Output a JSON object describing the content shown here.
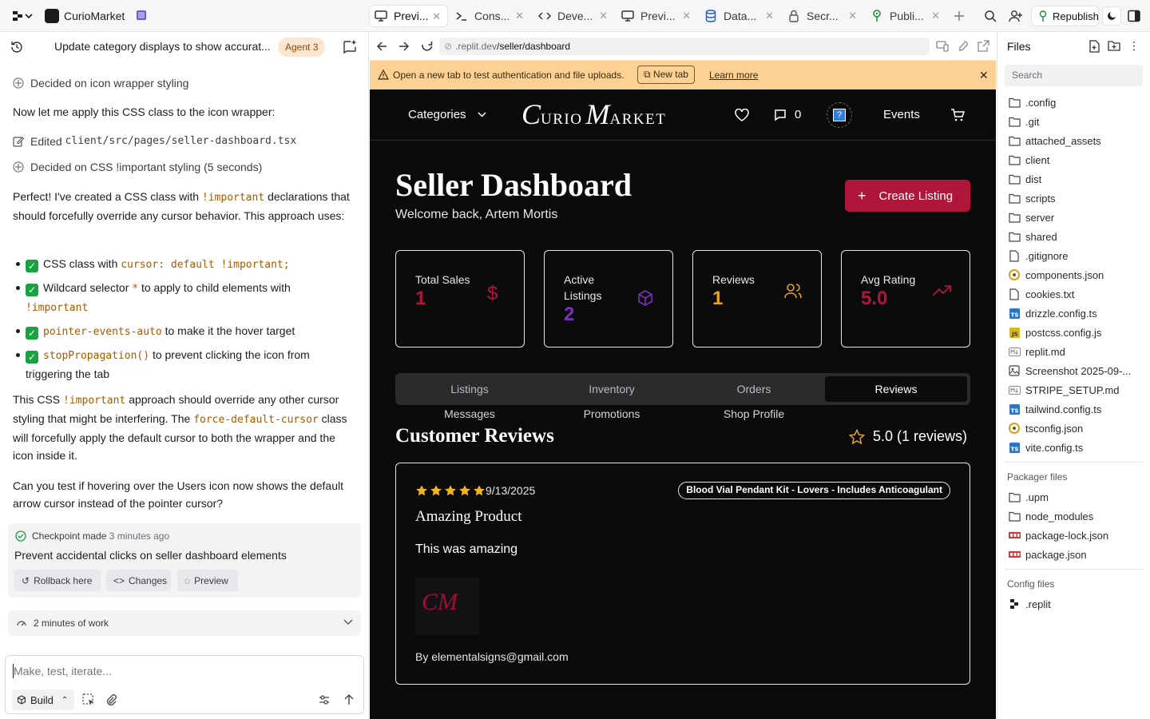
{
  "topbar": {
    "project_name": "CurioMarket",
    "tabs": [
      {
        "label": "Previ...",
        "icon": "monitor-icon",
        "active": true
      },
      {
        "label": "Cons...",
        "icon": "terminal-icon"
      },
      {
        "label": "Deve...",
        "icon": "code-icon"
      },
      {
        "label": "Previ...",
        "icon": "monitor-icon"
      },
      {
        "label": "Data...",
        "icon": "database-icon"
      },
      {
        "label": "Secr...",
        "icon": "lock-icon"
      },
      {
        "label": "Publi...",
        "icon": "deploy-icon"
      }
    ],
    "republish_label": "Republish"
  },
  "agent": {
    "thread_title": "Update category displays to show accurat...",
    "agent_badge": "Agent 3",
    "step1": "Decided on icon wrapper styling",
    "msg1": "Now let me apply this CSS class to the icon wrapper:",
    "edited_prefix": "Edited",
    "edited_file": "client/src/pages/seller-dashboard.tsx",
    "step2": "Decided on CSS !important styling (5 seconds)",
    "p1a": "Perfect! I've created a CSS class with",
    "p1_code": "!important",
    "p1b": "declarations that should forcefully override any cursor behavior. This approach uses:",
    "b1_text": "CSS class with",
    "b1_code": "cursor: default !important;",
    "b2_text": "Wildcard selector",
    "b2_code": "*",
    "b2_text2": "to apply to child elements with",
    "b2_code2": "!important",
    "b3_code": "pointer-events-auto",
    "b3_text": "to make it the hover target",
    "b4_code": "stopPropagation()",
    "b4_text": "to prevent clicking the icon from triggering the tab",
    "p2a": "This CSS",
    "p2_code": "!important",
    "p2b": "approach should override any other cursor styling that might be interfering. The",
    "p2_code2": "force-default-cursor",
    "p2c": "class will forcefully apply the default cursor to both the wrapper and the icon inside it.",
    "p3": "Can you test if hovering over the Users icon now shows the default arrow cursor instead of the pointer cursor?",
    "checkpoint_label": "Checkpoint made",
    "checkpoint_time": "3 minutes ago",
    "checkpoint_desc": "Prevent accidental clicks on seller dashboard elements",
    "rollback_label": "Rollback here",
    "changes_label": "Changes",
    "preview_label": "Preview",
    "work_label": "2 minutes of work",
    "composer_placeholder": "Make, test, iterate...",
    "build_label": "Build"
  },
  "browser": {
    "url_domain": ".replit.dev",
    "url_path": "/seller/dashboard",
    "banner_text": "Open a new tab to test authentication and file uploads.",
    "new_tab_label": "New tab",
    "learn_more_label": "Learn more"
  },
  "site": {
    "categories_label": "Categories",
    "logo_text": "Curio Market",
    "logo_c": "C",
    "logo_urio": "URIO",
    "logo_m": "M",
    "logo_arket": "ARKET",
    "messages_count": "0",
    "events_label": "Events",
    "page_title": "Seller Dashboard",
    "welcome": "Welcome back, Artem Mortis",
    "create_listing_label": "Create Listing",
    "stats": [
      {
        "label": "Total Sales",
        "value": "1",
        "color": "#b0153a",
        "icon": "dollar-icon"
      },
      {
        "label": "Active Listings",
        "value": "2",
        "color": "#7b2fbf",
        "icon": "box-icon"
      },
      {
        "label": "Reviews",
        "value": "1",
        "color": "#e8a325",
        "icon": "users-icon"
      },
      {
        "label": "Avg Rating",
        "value": "5.0",
        "color": "#b0153a",
        "icon": "trending-up-icon"
      }
    ],
    "tabs": [
      "Listings",
      "Inventory",
      "Orders",
      "Reviews"
    ],
    "active_tab": "Reviews",
    "tabs_row2": [
      "Messages",
      "Promotions",
      "Shop Profile"
    ],
    "reviews_heading": "Customer Reviews",
    "reviews_summary": "5.0 (1 reviews)",
    "review": {
      "rating": 5,
      "date": "9/13/2025",
      "product": "Blood Vial Pendant Kit - Lovers - Includes Anticoagulant",
      "title": "Amazing Product",
      "body": "This was amazing",
      "image_text": "CM",
      "author": "By elementalsigns@gmail.com"
    }
  },
  "files": {
    "title": "Files",
    "search_placeholder": "Search",
    "items": [
      {
        "name": ".config",
        "type": "folder"
      },
      {
        "name": ".git",
        "type": "folder"
      },
      {
        "name": "attached_assets",
        "type": "folder"
      },
      {
        "name": "client",
        "type": "folder"
      },
      {
        "name": "dist",
        "type": "folder"
      },
      {
        "name": "scripts",
        "type": "folder"
      },
      {
        "name": "server",
        "type": "folder"
      },
      {
        "name": "shared",
        "type": "folder"
      },
      {
        "name": ".gitignore",
        "type": "file"
      },
      {
        "name": "components.json",
        "type": "json"
      },
      {
        "name": "cookies.txt",
        "type": "file"
      },
      {
        "name": "drizzle.config.ts",
        "type": "ts"
      },
      {
        "name": "postcss.config.js",
        "type": "js"
      },
      {
        "name": "replit.md",
        "type": "md"
      },
      {
        "name": "Screenshot 2025-09-...",
        "type": "image"
      },
      {
        "name": "STRIPE_SETUP.md",
        "type": "md"
      },
      {
        "name": "tailwind.config.ts",
        "type": "ts"
      },
      {
        "name": "tsconfig.json",
        "type": "json"
      },
      {
        "name": "vite.config.ts",
        "type": "ts"
      }
    ],
    "packager_title": "Packager files",
    "packager_items": [
      {
        "name": ".upm",
        "type": "folder"
      },
      {
        "name": "node_modules",
        "type": "folder"
      },
      {
        "name": "package-lock.json",
        "type": "npm"
      },
      {
        "name": "package.json",
        "type": "npm"
      }
    ],
    "config_title": "Config files",
    "config_items": [
      {
        "name": ".replit",
        "type": "replit"
      }
    ]
  }
}
